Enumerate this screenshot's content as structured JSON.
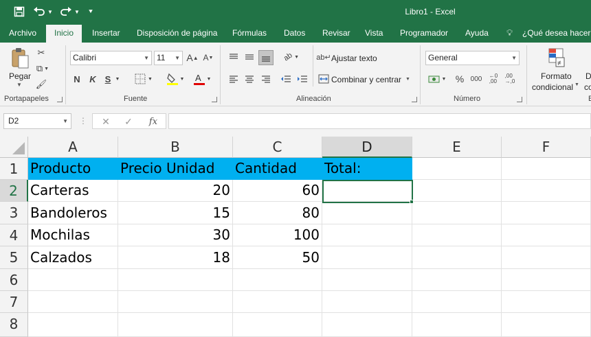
{
  "window": {
    "title": "Libro1  -  Excel"
  },
  "quick_access": {
    "save_icon": "save-icon",
    "undo_icon": "undo-icon",
    "redo_icon": "redo-icon",
    "customize_icon": "customize-icon"
  },
  "tabs": [
    "Archivo",
    "Inicio",
    "Insertar",
    "Disposición de página",
    "Fórmulas",
    "Datos",
    "Revisar",
    "Vista",
    "Programador",
    "Ayuda"
  ],
  "active_tab": "Inicio",
  "tell_me": "¿Qué desea hacer?",
  "ribbon": {
    "clipboard": {
      "paste": "Pegar",
      "label": "Portapapeles"
    },
    "font": {
      "name": "Calibri",
      "size": "11",
      "bold": "N",
      "italic": "K",
      "underline": "S",
      "label": "Fuente"
    },
    "alignment": {
      "wrap": "Ajustar texto",
      "merge": "Combinar y centrar",
      "label": "Alineación"
    },
    "number": {
      "format": "General",
      "label": "Número"
    },
    "styles": {
      "conditional_line1": "Formato",
      "conditional_line2": "condicional",
      "next_line1": "D",
      "next_line2": "co"
    }
  },
  "formula_bar": {
    "name_box": "D2",
    "formula": ""
  },
  "grid": {
    "columns": [
      "A",
      "B",
      "C",
      "D",
      "E",
      "F"
    ],
    "rows": [
      "1",
      "2",
      "3",
      "4",
      "5",
      "6",
      "7",
      "8"
    ],
    "selected_cell": "D2",
    "cells": {
      "A1": "Producto",
      "B1": "Precio Unidad",
      "C1": "Cantidad",
      "D1": "Total:",
      "A2": "Carteras",
      "B2": "20",
      "C2": "60",
      "A3": "Bandoleros",
      "B3": "15",
      "C3": "80",
      "A4": "Mochilas",
      "B4": "30",
      "C4": "100",
      "A5": "Calzados",
      "B5": "18",
      "C5": "50"
    }
  },
  "colors": {
    "excel_green": "#217346",
    "header_fill": "#00b0f0",
    "ribbon_bg": "#f3f3f3"
  }
}
